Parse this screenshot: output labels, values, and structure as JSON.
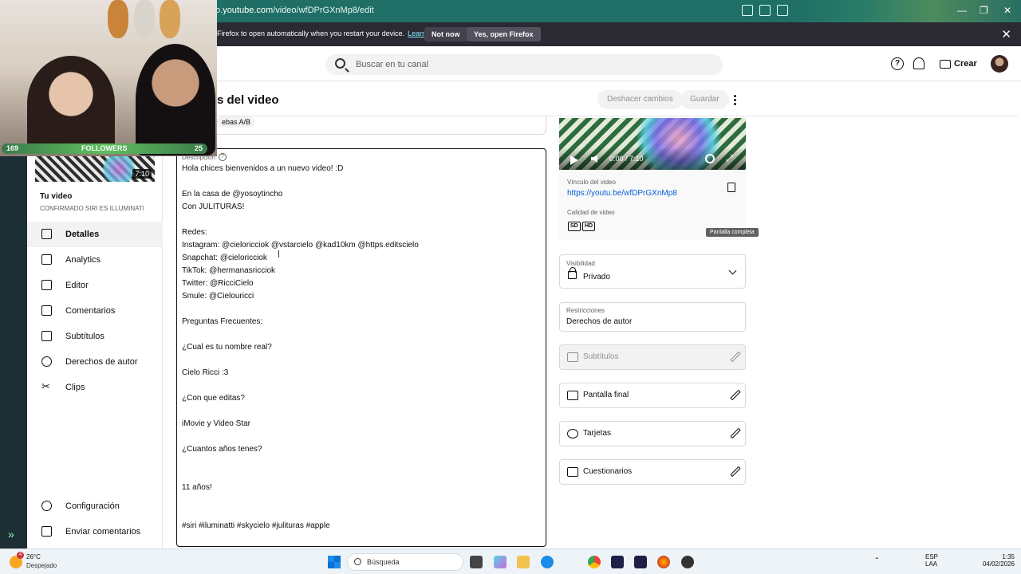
{
  "browser": {
    "url_prefix": "o.",
    "url_host": "youtube.com",
    "url_path": "/video/wfDPrGXnMp8/edit",
    "notification": {
      "message": "Firefox to open automatically when you restart your device.",
      "learn_more": "Learn more",
      "not_now": "Not now",
      "yes_open": "Yes, open Firefox"
    }
  },
  "webcam": {
    "followers_left": "169",
    "followers_label": "FOLLOWERS",
    "followers_right": "25"
  },
  "header": {
    "search_placeholder": "Buscar en tu canal",
    "create_label": "Crear"
  },
  "sidebar": {
    "thumb_duration": "7:10",
    "your_video": "Tu video",
    "video_title": "CONFIRMADO SIRI ES ILLUMINATI",
    "items": [
      {
        "label": "Detalles",
        "icon": "pencil-icon",
        "active": true
      },
      {
        "label": "Analytics",
        "icon": "analytics-icon"
      },
      {
        "label": "Editor",
        "icon": "editor-icon"
      },
      {
        "label": "Comentarios",
        "icon": "comments-icon"
      },
      {
        "label": "Subtítulos",
        "icon": "subtitles-icon"
      },
      {
        "label": "Derechos de autor",
        "icon": "copyright-icon"
      },
      {
        "label": "Clips",
        "icon": "scissors-icon"
      }
    ],
    "bottom": [
      {
        "label": "Configuración",
        "icon": "gear-icon"
      },
      {
        "label": "Enviar comentarios",
        "icon": "feedback-icon"
      }
    ]
  },
  "main": {
    "page_title": "s del video",
    "undo_label": "Deshacer cambios",
    "save_label": "Guardar",
    "ab_label": "ebas A/B",
    "description_label": "Descripción",
    "description_text": "Hola chices bienvenidos a un nuevo video! :D\n\nEn la casa de @yosoytincho\nCon JULITURAS!\n\nRedes:\nInstagram: @cieloricciok @vstarcielo @kad10km @https.editscielo\nSnapchat: @cieloricciok\nTikTok: @hermanasricciok\nTwitter: @RicciCielo\nSmule: @Cielouricci\n\nPreguntas Frecuentes:\n\n¿Cual es tu nombre real?\n\nCielo Ricci :3\n\n¿Con que editas?\n\niMovie y Video Star\n\n¿Cuantos años tenes?\n\n\n11 años!\n\n\n#siri #iluminatti #skycielo #julituras #apple"
  },
  "right": {
    "player_time": "0:00 / 7:10",
    "fullscreen_tooltip": "Pantalla completa",
    "link_label": "Vínculo del video",
    "link_url": "https://youtu.be/wfDPrGXnMp8",
    "quality_label": "Calidad de video",
    "quality_sd": "SD",
    "quality_hd": "HD",
    "visibility_label": "Visibilidad",
    "visibility_value": "Privado",
    "restrictions_label": "Restricciones",
    "restrictions_value": "Derechos de autor",
    "subtitles": "Subtítulos",
    "end_screen": "Pantalla final",
    "cards": "Tarjetas",
    "quizzes": "Cuestionarios"
  },
  "taskbar": {
    "weather_badge": "4",
    "temperature": "26°C",
    "weather_desc": "Despejado",
    "search_placeholder": "Búsqueda",
    "lang_top": "ESP",
    "lang_bottom": "LAA",
    "time": "1:35",
    "date": "04/02/2026"
  },
  "colors": {
    "browser_bar": "#1f6f66",
    "notification_bar": "#2b2a33",
    "link": "#065fd4"
  }
}
